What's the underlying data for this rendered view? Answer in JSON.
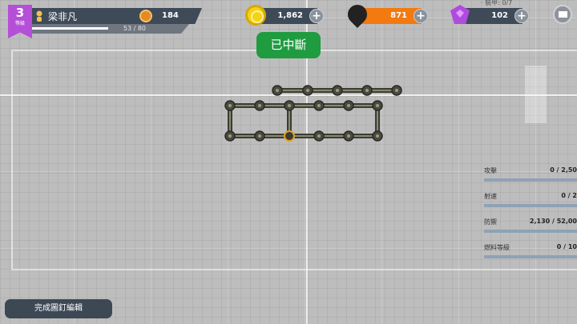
{
  "player": {
    "level": "3",
    "level_label": "等級",
    "name": "梁非凡",
    "trophies": "184",
    "xp_text": "53 / 80",
    "xp_progress": 0.6625
  },
  "resources": {
    "gold": "1,862",
    "oil": "871",
    "gems": "102",
    "plus": "+"
  },
  "top_right_partial": "· 裝甲: 0/7",
  "status": "已中斷",
  "stats": [
    {
      "label": "攻擊",
      "value": "0 / 2,50"
    },
    {
      "label": "射速",
      "value": "0 / 2"
    },
    {
      "label": "防禦",
      "value": "2,130 / 52,00"
    },
    {
      "label": "燃料等級",
      "value": "0 / 10"
    }
  ],
  "finish_button": "完成圖釘編輯",
  "icons": {
    "gold": "gold-coin-icon",
    "oil": "oil-drop-icon",
    "gems": "gem-icon",
    "trophy": "trophy-icon",
    "settings": "flag-icon"
  },
  "colors": {
    "status_green": "#1f9b40",
    "oil_orange": "#f27a11",
    "level_purple": "#b54fd8",
    "panel_dark": "#3e4a58"
  }
}
